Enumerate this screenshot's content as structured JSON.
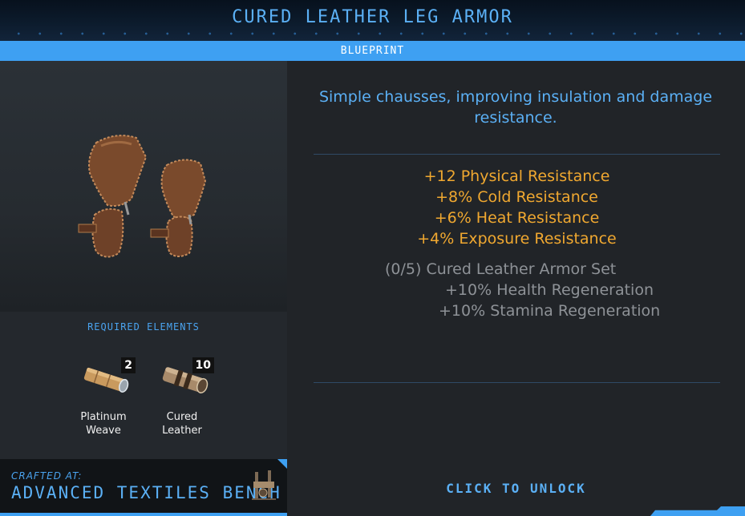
{
  "header": {
    "title": "CURED LEATHER LEG ARMOR",
    "subtitle": "BLUEPRINT"
  },
  "item": {
    "image_icon": "leather-leg-armor-icon"
  },
  "requirements": {
    "title": "REQUIRED ELEMENTS",
    "items": [
      {
        "name_line1": "Platinum",
        "name_line2": "Weave",
        "count": "2",
        "icon": "platinum-weave-icon"
      },
      {
        "name_line1": "Cured",
        "name_line2": "Leather",
        "count": "10",
        "icon": "cured-leather-icon"
      }
    ]
  },
  "crafting": {
    "label": "CRAFTED AT:",
    "station": "ADVANCED TEXTILES BENCH",
    "station_icon": "textiles-bench-icon"
  },
  "details": {
    "description": "Simple chausses, improving insulation and damage resistance.",
    "stats": [
      "+12 Physical Resistance",
      "+8% Cold Resistance",
      "+6% Heat Resistance",
      "+4% Exposure Resistance"
    ],
    "set": {
      "title": "(0/5) Cured Leather Armor Set",
      "bonuses": [
        "+10% Health Regeneration",
        "+10% Stamina Regeneration"
      ]
    },
    "unlock_label": "CLICK TO UNLOCK"
  },
  "colors": {
    "accent": "#3ea0f2",
    "title_blue": "#5bb0f5",
    "stat_orange": "#f0a830",
    "set_gray": "#8e9297"
  }
}
